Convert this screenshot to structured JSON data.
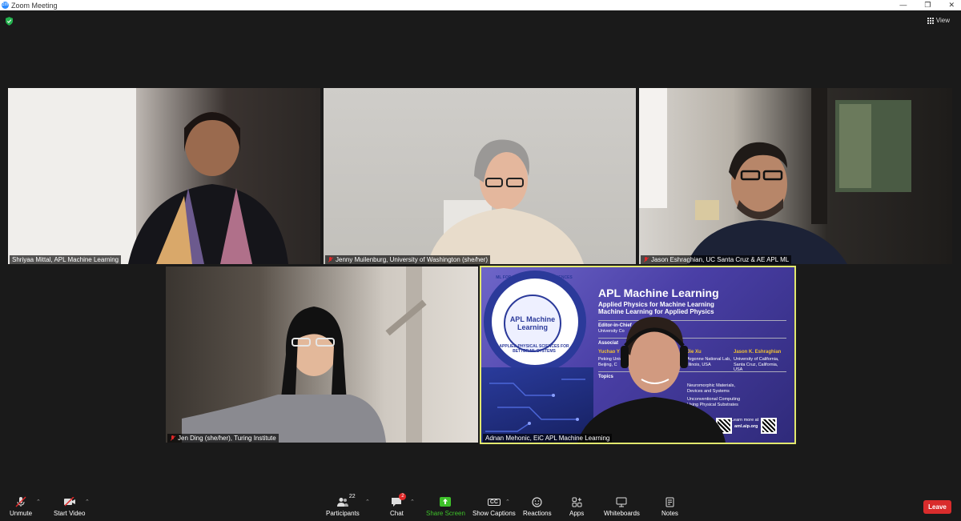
{
  "window": {
    "title": "Zoom Meeting",
    "app_icon_text": "zm"
  },
  "header": {
    "view_label": "View"
  },
  "participants": [
    {
      "name": "Shriyaa Mittal, APL Machine Learning",
      "muted": false
    },
    {
      "name": "Jenny Muilenburg, University of Washington (she/her)",
      "muted": true
    },
    {
      "name": "Jason Eshraghian, UC Santa Cruz & AE APL ML",
      "muted": true
    },
    {
      "name": "Jen Ding (she/her), Turing Institute",
      "muted": true
    },
    {
      "name": "Adnan Mehonic, EiC APL Machine Learning",
      "muted": false,
      "active_speaker": true
    }
  ],
  "slide": {
    "circle_top": "ML FOR APPLIED PHYSICAL SCIENCES",
    "circle_inner": "APL Machine Learning",
    "circle_bottom": "APPLIED PHYSICAL SCIENCES FOR BETTER ML SYSTEMS",
    "title": "APL Machine Learning",
    "subtitle_1": "Applied Physics for Machine Learning",
    "subtitle_2": "Machine Learning for Applied Physics",
    "editor_label": "Editor-in-Chief",
    "editor_org": "University Co",
    "associate_label": "Associat",
    "assoc_1_name": "Yuchao Y",
    "assoc_1_org": "Peking Univ Beijing, C",
    "assoc_2_name": "Jie Xu",
    "assoc_2_org": "Argonne National Lab, Illinois, USA",
    "assoc_3_name": "Jason K. Eshraghian",
    "assoc_3_org": "University of California, Santa Cruz, California, USA",
    "topics_label": "Topics",
    "topic_1": "Neuromorphic Materials, Devices and Systems",
    "topic_2": "Unconventional Computing Using Physical Substrates",
    "learn_more": "Learn more at",
    "url": "aml.aip.org"
  },
  "toolbar": {
    "unmute": "Unmute",
    "start_video": "Start Video",
    "participants": "Participants",
    "participants_count": "22",
    "chat": "Chat",
    "chat_badge": "2",
    "share_screen": "Share Screen",
    "show_captions": "Show Captions",
    "captions_icon_text": "CC",
    "reactions": "Reactions",
    "apps": "Apps",
    "whiteboards": "Whiteboards",
    "notes": "Notes",
    "leave": "Leave"
  },
  "colors": {
    "share_green": "#3ec12a",
    "leave_red": "#d92c2c",
    "speaker_outline": "#e2e86d"
  }
}
